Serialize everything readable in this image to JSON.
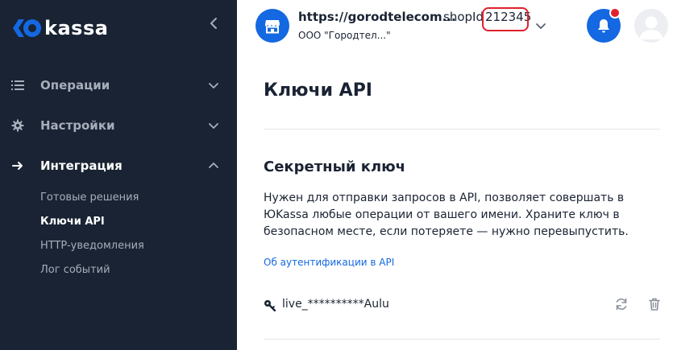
{
  "sidebar": {
    "logo_text": "kassa",
    "items": [
      {
        "label": "Операции",
        "icon": "list-icon",
        "expanded": false
      },
      {
        "label": "Настройки",
        "icon": "gear-icon",
        "expanded": false
      },
      {
        "label": "Интеграция",
        "icon": "arrow-right-icon",
        "expanded": true
      }
    ],
    "subitems": [
      {
        "label": "Готовые решения",
        "active": false
      },
      {
        "label": "Ключи API",
        "active": true
      },
      {
        "label": "HTTP-уведомления",
        "active": false
      },
      {
        "label": "Лог событий",
        "active": false
      }
    ]
  },
  "header": {
    "shop_url": "https://gorodtelecom...",
    "shop_id_label": "shopId",
    "shop_id_value": "212345",
    "shop_org": "ООО \"Городтел...\""
  },
  "main": {
    "title": "Ключи API",
    "section_title": "Секретный ключ",
    "section_description": "Нужен для отправки запросов в API, позволяет совершать в ЮKassa любые операции от вашего имени. Храните ключ в безопасном месте, если потеряете — нужно перевыпустить.",
    "auth_link": "Об аутентификации в API",
    "key_value": "live_**********Aulu"
  },
  "colors": {
    "sidebar_bg": "#1a2333",
    "accent": "#1468e1",
    "highlight_box": "#e1202c",
    "notification_dot": "#e1202c"
  }
}
